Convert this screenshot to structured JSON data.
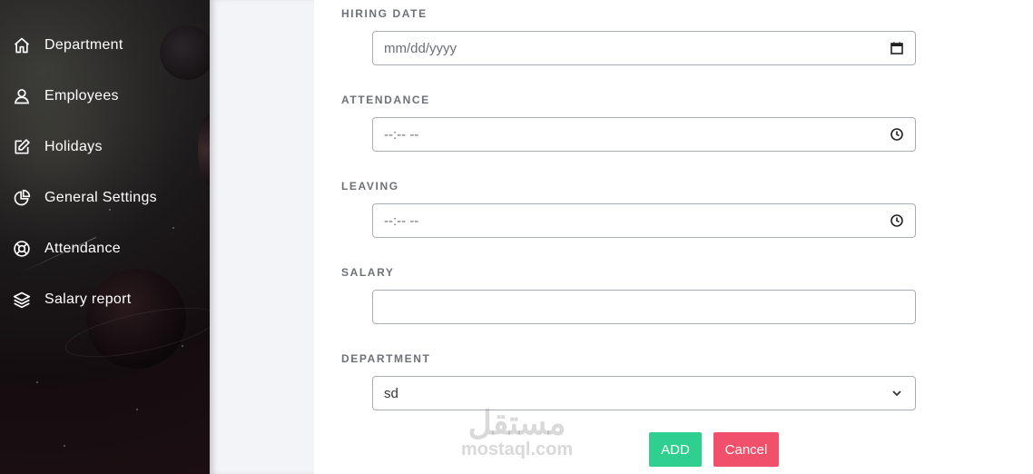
{
  "sidebar": {
    "items": [
      {
        "label": "Department",
        "icon": "home-icon"
      },
      {
        "label": "Employees",
        "icon": "user-icon"
      },
      {
        "label": "Holidays",
        "icon": "edit-icon"
      },
      {
        "label": "General Settings",
        "icon": "pie-chart-icon"
      },
      {
        "label": "Attendance",
        "icon": "lifebuoy-icon"
      },
      {
        "label": "Salary report",
        "icon": "layers-icon"
      }
    ]
  },
  "form": {
    "hiring_date": {
      "label": "HIRING DATE",
      "placeholder": "mm/dd/yyyy"
    },
    "attendance": {
      "label": "ATTENDANCE",
      "placeholder": "--:-- --"
    },
    "leaving": {
      "label": "LEAVING",
      "placeholder": "--:-- --"
    },
    "salary": {
      "label": "SALARY",
      "value": ""
    },
    "department": {
      "label": "DEPARTMENT",
      "selected": "sd"
    },
    "add_label": "ADD",
    "cancel_label": "Cancel"
  },
  "watermark": {
    "arabic": "مستقل",
    "latin": "mostaql.com"
  },
  "colors": {
    "add": "#2fcf8f",
    "cancel": "#f0506a",
    "label": "#6d7278"
  }
}
